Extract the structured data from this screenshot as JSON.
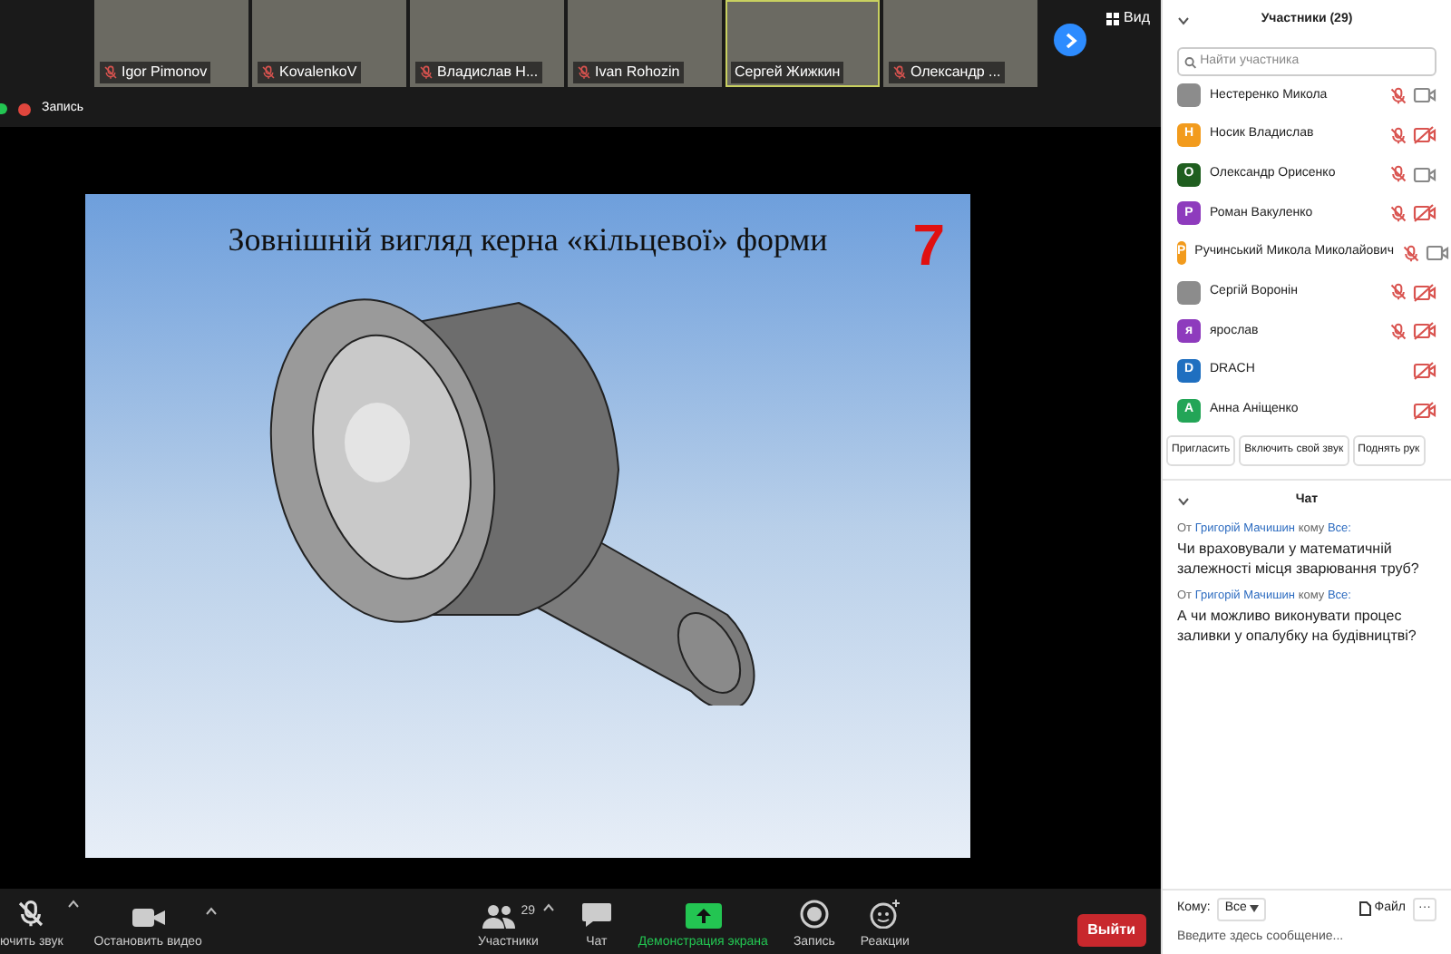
{
  "video_strip": [
    {
      "name": "Igor Pimonov",
      "muted": true,
      "speaking": false
    },
    {
      "name": "KovalenkoV",
      "muted": true,
      "speaking": false
    },
    {
      "name": "Владислав Н...",
      "muted": true,
      "speaking": false
    },
    {
      "name": "Ivan Rohozin",
      "muted": true,
      "speaking": false
    },
    {
      "name": "Сергей Жижкин",
      "muted": false,
      "speaking": true
    },
    {
      "name": "Олександр ...",
      "muted": true,
      "speaking": false
    }
  ],
  "view_button": "Вид",
  "recording": {
    "label": "Запись"
  },
  "slide": {
    "title": "Зовнішній вигляд керна «кільцевої» форми",
    "number": "7"
  },
  "toolbar": [
    {
      "kind": "mic",
      "label": "ючить звук",
      "caret": true
    },
    {
      "kind": "video",
      "label": "Остановить видео",
      "caret": true
    },
    {
      "kind": "participants",
      "label": "Участники",
      "count": "29",
      "caret": true
    },
    {
      "kind": "chat",
      "label": "Чат",
      "caret": false
    },
    {
      "kind": "share",
      "label": "Демонстрация экрана",
      "caret": false
    },
    {
      "kind": "record",
      "label": "Запись",
      "caret": false
    },
    {
      "kind": "reactions",
      "label": "Реакции",
      "caret": false
    }
  ],
  "leave_button": "Выйти",
  "participants_panel": {
    "title": "Участники (29)",
    "search": {
      "placeholder": "Найти участника"
    },
    "participants": [
      {
        "name": "Нестеренко Микола",
        "avatar": {
          "kind": "photo"
        },
        "mic_muted": true,
        "video_off": false
      },
      {
        "name": "Носик Владислав",
        "avatar": {
          "kind": "letter",
          "letter": "Н",
          "color": "#f29b1d"
        },
        "mic_muted": true,
        "video_off": true
      },
      {
        "name": "Олександр Орисенко",
        "avatar": {
          "kind": "letter",
          "letter": "О",
          "color": "#1f5e1f"
        },
        "mic_muted": true,
        "video_off": false
      },
      {
        "name": "Роман Вакуленко",
        "avatar": {
          "kind": "letter",
          "letter": "Р",
          "color": "#8e3bbd"
        },
        "mic_muted": true,
        "video_off": true
      },
      {
        "name": "Ручинський Микола Миколайович",
        "avatar": {
          "kind": "letter",
          "letter": "Р",
          "color": "#f29b1d"
        },
        "mic_muted": true,
        "video_off": false
      },
      {
        "name": "Сергій Воронін",
        "avatar": {
          "kind": "photo"
        },
        "mic_muted": true,
        "video_off": true
      },
      {
        "name": "ярослав",
        "avatar": {
          "kind": "letter",
          "letter": "я",
          "color": "#8e3bbd"
        },
        "mic_muted": true,
        "video_off": true
      },
      {
        "name": "DRACH",
        "avatar": {
          "kind": "letter",
          "letter": "D",
          "color": "#1f6fc0"
        },
        "mic_muted": false,
        "video_off": true
      },
      {
        "name": "Анна Аніщенко",
        "avatar": {
          "kind": "letter",
          "letter": "А",
          "color": "#23a557"
        },
        "mic_muted": false,
        "video_off": true
      }
    ],
    "buttons": [
      "Пригласить",
      "Включить свой звук",
      "Поднять рук"
    ]
  },
  "chat_panel": {
    "title": "Чат",
    "messages": [
      {
        "from_prefix": "От",
        "sender": "Григорій Мачишин",
        "to_prefix": "кому",
        "recipient": "Все:",
        "text": "Чи враховували у математичній залежності місця зварювання труб?"
      },
      {
        "from_prefix": "От",
        "sender": "Григорій Мачишин",
        "to_prefix": "кому",
        "recipient": "Все:",
        "text": "А чи можливо виконувати процес заливки у опалубку на будівництві?"
      }
    ],
    "to_label": "Кому:",
    "to_value": "Все",
    "file_button": "Файл",
    "more_button": "···",
    "input": {
      "placeholder": "Введите здесь сообщение..."
    }
  }
}
